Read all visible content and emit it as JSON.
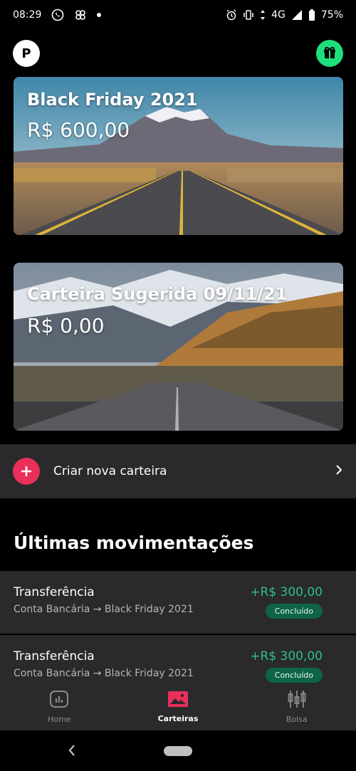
{
  "status_bar": {
    "time": "08:29",
    "network": "4G",
    "battery": "75%"
  },
  "header": {
    "avatar_initial": "P"
  },
  "wallets": [
    {
      "name": "Black Friday 2021",
      "value": "R$ 600,00"
    },
    {
      "name": "Carteira Sugerida 09/11/21",
      "value": "R$ 0,00"
    }
  ],
  "create_wallet": {
    "label": "Criar nova carteira"
  },
  "section_title": "Últimas movimentações",
  "transactions": [
    {
      "title": "Transferência",
      "subtitle": "Conta Bancária → Black Friday 2021",
      "amount": "+R$ 300,00",
      "status": "Concluído"
    },
    {
      "title": "Transferência",
      "subtitle": "Conta Bancária → Black Friday 2021",
      "amount": "+R$ 300,00",
      "status": "Concluído"
    }
  ],
  "bottom_nav": {
    "items": [
      {
        "label": "Home",
        "icon": "home-chart-icon"
      },
      {
        "label": "Carteiras",
        "icon": "wallet-image-icon",
        "active": true
      },
      {
        "label": "Bolsa",
        "icon": "candlestick-icon"
      }
    ]
  },
  "colors": {
    "accent_pink": "#e8305a",
    "gift_green": "#1ee07a",
    "positive_green": "#2fbf8c",
    "badge_green": "#0d6447",
    "surface": "#2a2a2c"
  }
}
